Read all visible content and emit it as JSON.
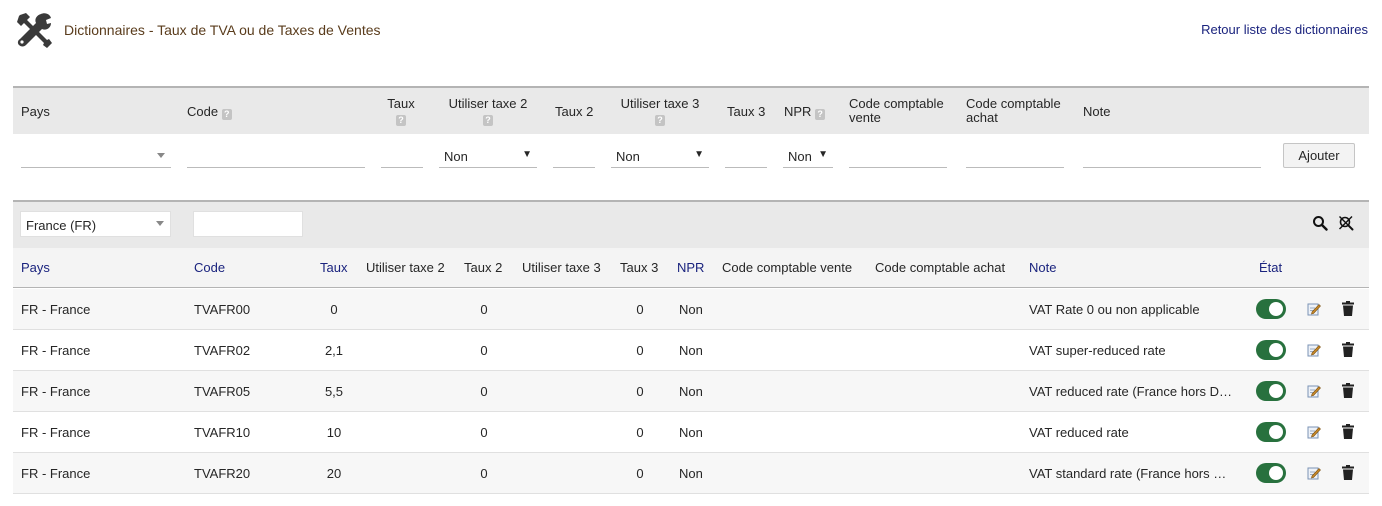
{
  "header": {
    "title": "Dictionnaires - Taux de TVA ou de Taxes de Ventes",
    "back_link": "Retour liste des dictionnaires"
  },
  "add_form": {
    "headers": {
      "pays": "Pays",
      "code": "Code",
      "taux": "Taux",
      "taxe2": "Utiliser taxe 2",
      "taux2": "Taux 2",
      "taxe3": "Utiliser taxe 3",
      "taux3": "Taux 3",
      "npr": "NPR",
      "cc_vente": "Code comptable vente",
      "cc_achat": "Code comptable achat",
      "note": "Note"
    },
    "help_glyph": "?",
    "taxe2_value": "Non",
    "taxe3_value": "Non",
    "npr_value": "Non",
    "add_button": "Ajouter"
  },
  "filters": {
    "country": "France (FR)",
    "code": ""
  },
  "columns": {
    "pays": "Pays",
    "code": "Code",
    "taux": "Taux",
    "taxe2": "Utiliser taxe 2",
    "taux2": "Taux 2",
    "taxe3": "Utiliser taxe 3",
    "taux3": "Taux 3",
    "npr": "NPR",
    "cc_vente": "Code comptable vente",
    "cc_achat": "Code comptable achat",
    "note": "Note",
    "etat": "État"
  },
  "rows": [
    {
      "pays": "FR - France",
      "code": "TVAFR00",
      "taux": "0",
      "taux2": "0",
      "taux3": "0",
      "npr": "Non",
      "note": "VAT Rate 0 ou non applicable",
      "active": true
    },
    {
      "pays": "FR - France",
      "code": "TVAFR02",
      "taux": "2,1",
      "taux2": "0",
      "taux3": "0",
      "npr": "Non",
      "note": "VAT super-reduced rate",
      "active": true
    },
    {
      "pays": "FR - France",
      "code": "TVAFR05",
      "taux": "5,5",
      "taux2": "0",
      "taux3": "0",
      "npr": "Non",
      "note": "VAT reduced rate (France hors DOM-TOM)",
      "active": true
    },
    {
      "pays": "FR - France",
      "code": "TVAFR10",
      "taux": "10",
      "taux2": "0",
      "taux3": "0",
      "npr": "Non",
      "note": "VAT reduced rate",
      "active": true
    },
    {
      "pays": "FR - France",
      "code": "TVAFR20",
      "taux": "20",
      "taux2": "0",
      "taux3": "0",
      "npr": "Non",
      "note": "VAT standard rate (France hors DOM-TOM)",
      "active": true
    }
  ],
  "icons": {
    "header": "tools-icon",
    "search": "search-icon",
    "clear": "clear-filter-icon",
    "edit": "edit-icon",
    "delete": "trash-icon",
    "toggle_color": "#28713e"
  }
}
